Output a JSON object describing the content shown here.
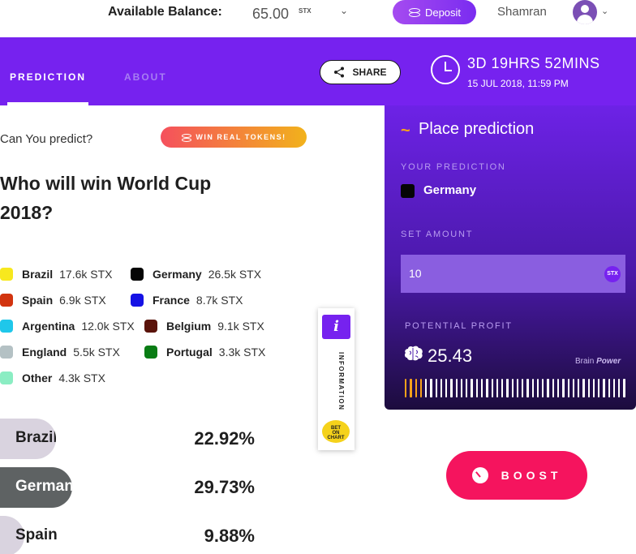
{
  "topbar": {
    "balance_label": "Available Balance:",
    "balance_value": "65.00",
    "balance_unit": "STX",
    "deposit_label": "Deposit",
    "username": "Shamran"
  },
  "header": {
    "tabs": [
      {
        "label": "PREDICTION",
        "active": true
      },
      {
        "label": "ABOUT",
        "active": false
      }
    ],
    "share_label": "SHARE",
    "countdown": "3D 19HRS 52MINS",
    "deadline": "15 JUL 2018, 11:59 PM"
  },
  "main": {
    "prompt": "Can You predict?",
    "badge": "WIN REAL TOKENS!",
    "question": "Who will win World Cup 2018?",
    "legend": [
      {
        "name": "Brazil",
        "value": "17.6k STX",
        "color": "#f7e81e"
      },
      {
        "name": "Germany",
        "value": "26.5k STX",
        "color": "#050505"
      },
      {
        "name": "Spain",
        "value": "6.9k STX",
        "color": "#d2340f"
      },
      {
        "name": "France",
        "value": "8.7k STX",
        "color": "#1512e5"
      },
      {
        "name": "Argentina",
        "value": "12.0k STX",
        "color": "#1fc7ea"
      },
      {
        "name": "Belgium",
        "value": "9.1k STX",
        "color": "#5a130a"
      },
      {
        "name": "England",
        "value": "5.5k STX",
        "color": "#b4c1c4"
      },
      {
        "name": "Portugal",
        "value": "3.3k STX",
        "color": "#097c14"
      },
      {
        "name": "Other",
        "value": "4.3k STX",
        "color": "#8bedc3"
      }
    ],
    "bars": [
      {
        "name": "Brazil",
        "percent": "22.92%",
        "fraction": 0.2292,
        "color": "#d9d3df",
        "text_color": "#1f1f1f"
      },
      {
        "name": "Germany",
        "percent": "29.73%",
        "fraction": 0.2973,
        "color": "#5e6263",
        "text_color": "#ffffff"
      },
      {
        "name": "Spain",
        "percent": "9.88%",
        "fraction": 0.0988,
        "color": "#d9d3df",
        "text_color": "#1f1f1f"
      }
    ]
  },
  "info_tab": {
    "icon": "i",
    "label": "INFORMATION",
    "logo_lines": [
      "BET",
      "ON",
      "CHART"
    ]
  },
  "panel": {
    "title": "Place prediction",
    "your_prediction_label": "YOUR PREDICTION",
    "prediction": "Germany",
    "prediction_color": "#050505",
    "set_amount_label": "SET AMOUNT",
    "amount": "10",
    "amount_coin": "STX",
    "potential_profit_label": "POTENTIAL PROFIT",
    "profit": "25.43",
    "brand_a": "Brain",
    "brand_b": "Power",
    "meter_total": 44,
    "meter_active": 4
  },
  "boost_label": "BOOST",
  "colors": {
    "header_purple": "#7622ef",
    "boost_pink": "#f5145e",
    "accent_orange": "#f7a21b"
  }
}
